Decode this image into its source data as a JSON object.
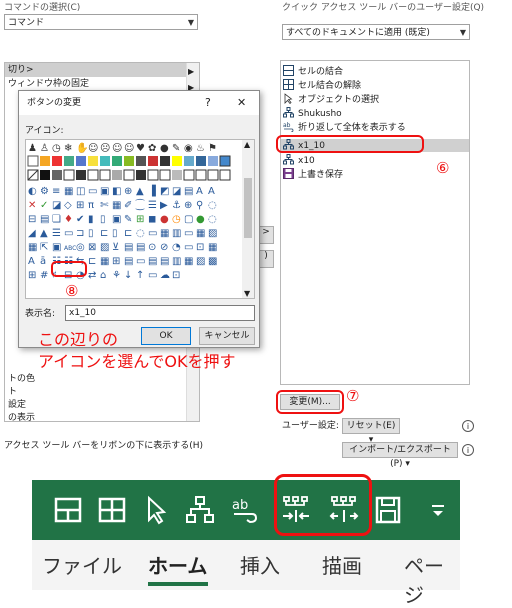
{
  "top": {
    "left_combo_label": "コマンドの選択(C)",
    "left_combo_value": "コマンド",
    "right_combo_label": "クイック アクセス ツール バーのユーザー設定(Q)",
    "right_combo_value": "すべてのドキュメントに適用 (既定)"
  },
  "left_list": {
    "items": [
      "切り>",
      "ウィンドウ枠の固定",
      "",
      "",
      "",
      "",
      "",
      "",
      "",
      "",
      "",
      "",
      "",
      "",
      "",
      "",
      "",
      "トの色",
      "ト",
      "設定",
      "の表示",
      ""
    ]
  },
  "right_list": {
    "items": [
      {
        "label": "セルの結合",
        "icon": "merge-cells-icon"
      },
      {
        "label": "セル結合の解除",
        "icon": "unmerge-cells-icon"
      },
      {
        "label": "オブジェクトの選択",
        "icon": "select-objects-icon"
      },
      {
        "label": "Shukusho",
        "icon": "macro-icon"
      },
      {
        "label": "折り返して全体を表示する",
        "icon": "wrap-text-icon"
      },
      {
        "label": "x1_10",
        "icon": "macro-icon",
        "selected": true
      },
      {
        "label": "x10",
        "icon": "macro-icon"
      },
      {
        "label": "上書き保存",
        "icon": "save-icon"
      }
    ]
  },
  "dialog": {
    "title": "ボタンの変更",
    "help": "?",
    "close": "✕",
    "icon_label": "アイコン:",
    "display_name_label": "表示名:",
    "display_name_value": "x1_10",
    "ok": "OK",
    "cancel": "キャンセル"
  },
  "annotations": {
    "n6": "⑥",
    "n7": "⑦",
    "n8": "⑧",
    "note_line1": "この辺りの",
    "note_line2": "アイコンを選んでOKを押す"
  },
  "bottom_controls": {
    "modify_button": "変更(M)...",
    "user_settings_label": "ユーザー設定:",
    "reset_button": "リセット(E) ▾",
    "import_export_button": "インポート/エクスポート(P) ▾",
    "show_below_ribbon": "アクセス ツール バーをリボンの下に表示する(H)"
  },
  "ribbon": {
    "icons": [
      "merge-cells-icon",
      "unmerge-cells-icon",
      "select-objects-icon",
      "macro-icon",
      "wrap-text-icon",
      "shrink-icon",
      "expand-icon",
      "save-icon",
      "customize-dropdown-icon"
    ],
    "background": "#217346"
  },
  "tabs": [
    "ファイル",
    "ホーム",
    "挿入",
    "描画",
    "ページ"
  ],
  "colors": {
    "accent_red": "#e11111",
    "excel_green": "#217346"
  }
}
